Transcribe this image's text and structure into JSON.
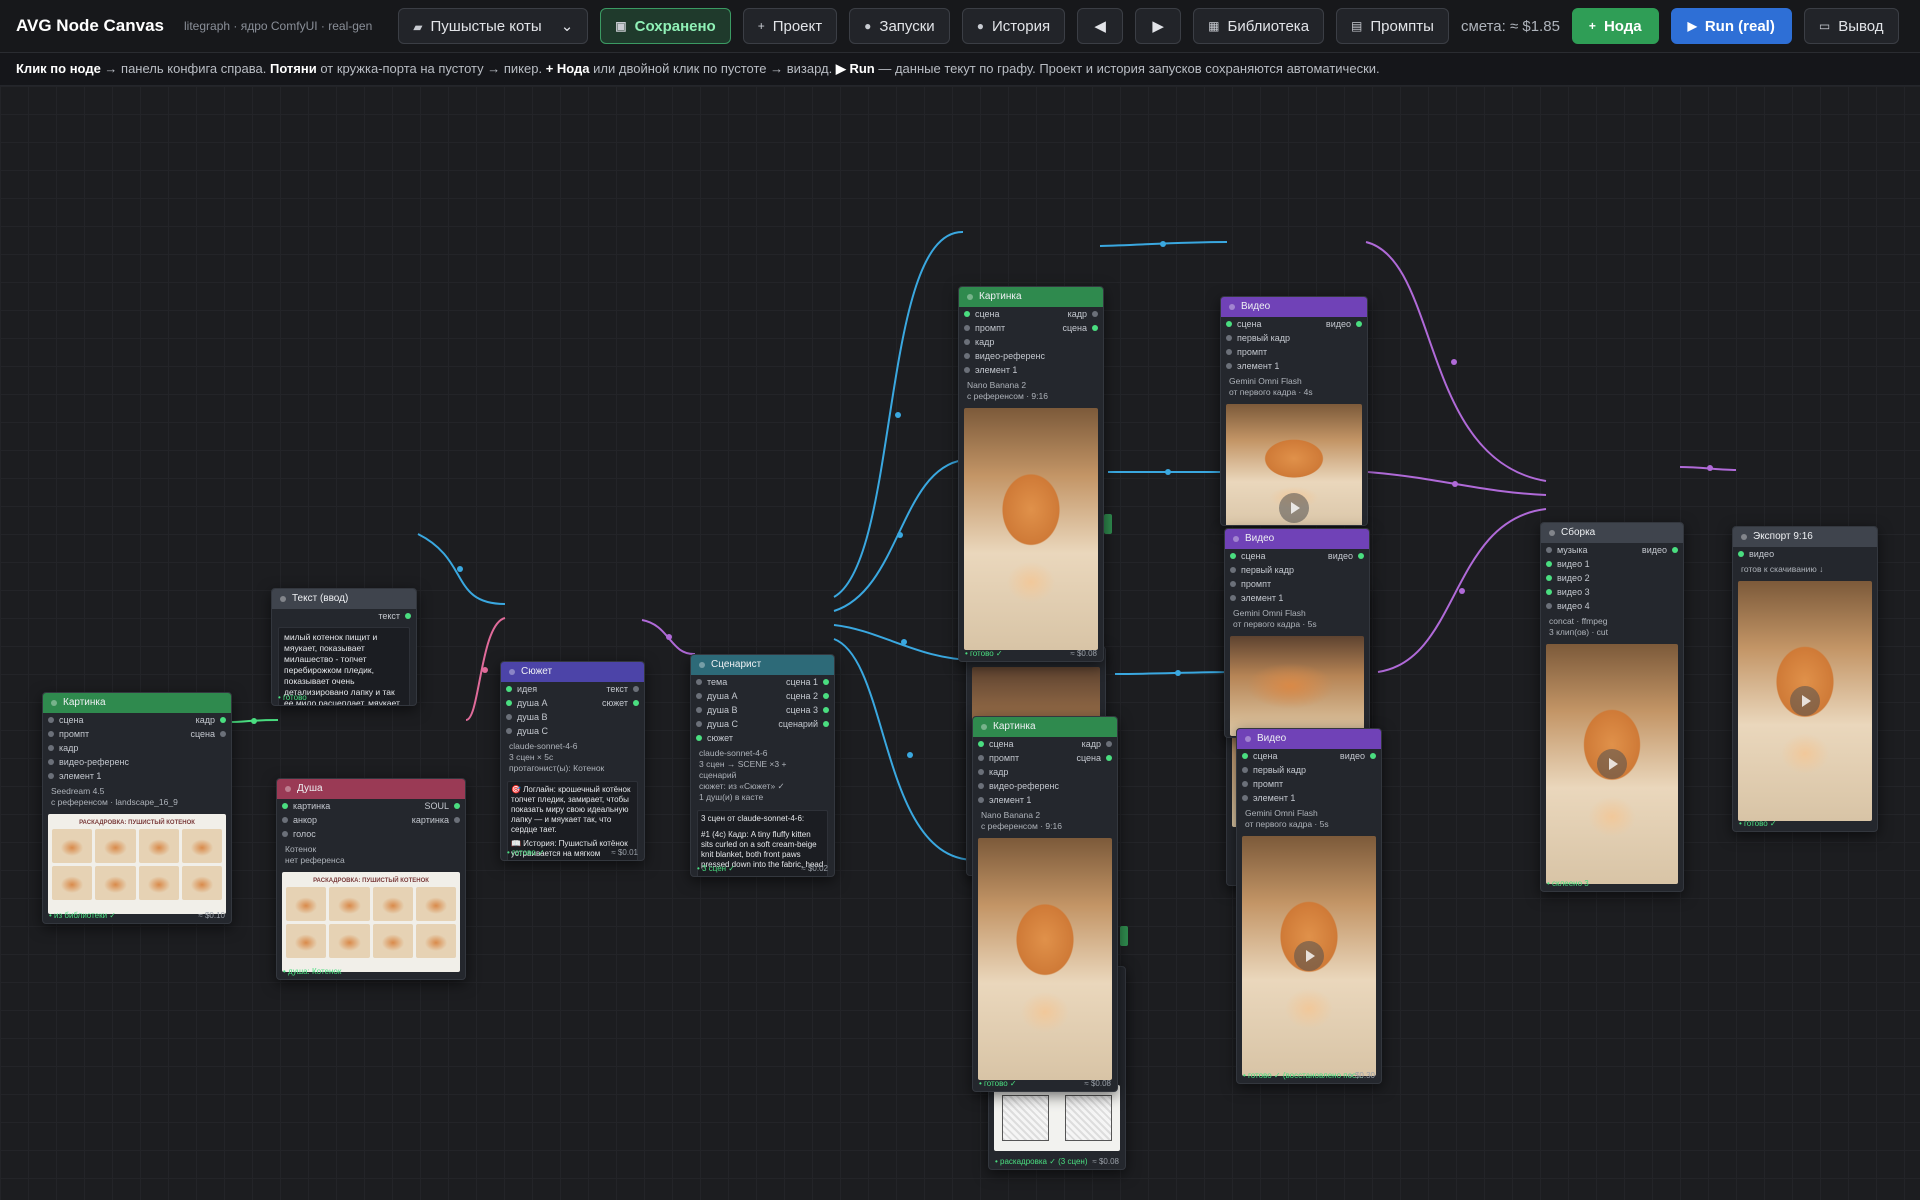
{
  "toolbar": {
    "title": "AVG Node Canvas",
    "subtitle": "litegraph · ядро ComfyUI · real-gen",
    "project_select": "Пушыстые коты",
    "saved": "Сохранено",
    "project": "Проект",
    "runs": "Запуски",
    "history": "История",
    "library": "Библиотека",
    "prompts": "Промпты",
    "cost": "смета: ≈ $1.85",
    "add_node": "Нода",
    "run": "Run (real)",
    "output": "Вывод"
  },
  "hint": {
    "p1": "Клик по ноде",
    "p2": " → панель конфига справа. ",
    "p3": "Потяни",
    "p4": " от кружка-порта на пустоту → пикер. ",
    "p5": "+ Нода",
    "p6": " или двойной клик по пустоте → визард. ",
    "p7": "▶ Run",
    "p8": " — данные текут по графу. Проект и история запусков сохраняются автоматически."
  },
  "colors": {
    "wire_blue": "#3aa8e0",
    "wire_purple": "#b06ad8",
    "wire_green": "#4ade80",
    "wire_pink": "#e06b9a"
  },
  "nodes": {
    "pic_left": {
      "title": "Картинка",
      "in": [
        "сцена",
        "промпт",
        "кадр",
        "видео-референс",
        "элемент 1"
      ],
      "out": [
        "кадр",
        "сцена"
      ],
      "meta": [
        "Seedream 4.5",
        "с референсом · landscape_16_9"
      ],
      "sheet_title": "РАСКАДРОВКА: ПУШИСТЫЙ КОТЕНОК",
      "status": "• из библиотеки ✓",
      "cost": "≈ $0.10"
    },
    "text_input": {
      "title": "Текст (ввод)",
      "out": "текст",
      "body": "милый котенок пищит и мяукает, показывает милашество - топчет перебирожком пледик, показывает очень детализировано лапку и так ее мило расцеплает, мяукает мило так же",
      "status": "• готово"
    },
    "soul": {
      "title": "Душа",
      "in": [
        "картинка",
        "анкор",
        "голос"
      ],
      "out": [
        "SOUL",
        "картинка"
      ],
      "meta": [
        "Котенок",
        "нет референса"
      ],
      "sheet_title": "РАСКАДРОВКА: ПУШИСТЫЙ КОТЕНОК",
      "status": "• душа: Котенок"
    },
    "plot": {
      "title": "Сюжет",
      "in": [
        "идея",
        "душа A",
        "душа B",
        "душа C"
      ],
      "out": [
        "текст",
        "сюжет"
      ],
      "meta": [
        "claude-sonnet-4-6",
        "3 сцен × 5с",
        "протагонист(ы): Котенок"
      ],
      "logline": "🎯 Логлайн: крошечный котёнок топчет пледик, замирает, чтобы показать миру свою идеальную лапку — и мяукает так, что сердце тает.",
      "story": "📖 История: Пушистый котёнок устраивается на мягком пледик…",
      "status": "• готово ✓",
      "cost": "≈ $0.01"
    },
    "writer": {
      "title": "Сценарист",
      "in": [
        "тема",
        "душа A",
        "душа B",
        "душа C",
        "сюжет"
      ],
      "out": [
        "сцена 1",
        "сцена 2",
        "сцена 3",
        "сценарий"
      ],
      "meta": [
        "claude-sonnet-4-6",
        "3 сцен → SCENE ×3 + сценарий",
        "сюжет: из «Сюжет» ✓",
        "1 душ(и) в касте"
      ],
      "box_head": "3 сцен от claude-sonnet-4-6:",
      "box_body": "#1 (4с) Кадр: A tiny fluffy kitten sits curled on a soft cream-beige knit blanket, both front paws pressed down into the fabric, head …",
      "status": "• 3 сцен ✓",
      "cost": "≈ $0.02"
    },
    "pic1": {
      "title": "Картинка",
      "in": [
        "сцена",
        "промпт",
        "кадр",
        "видео-референс",
        "элемент 1"
      ],
      "out": [
        "кадр",
        "сцена"
      ],
      "meta": [
        "Nano Banana 2",
        "с референсом · 9:16"
      ],
      "status": "• готово ✓",
      "cost": "≈ $0.08"
    },
    "pic2": {
      "title": "Картинка",
      "in": [
        "сцена",
        "промпт",
        "кадр",
        "видео-референс",
        "элемент 1"
      ],
      "out": [
        "кадр",
        "сцена"
      ],
      "meta": [
        "Nano Banana 2",
        "с референсом · 9:16"
      ],
      "status": "• готово ✓",
      "cost": "≈ $0.08"
    },
    "storyboard_peek": {
      "status": "• раскадровка ✓ (3 сцен)",
      "cost": "≈ $0.08"
    },
    "vid1": {
      "title": "Видео",
      "in": [
        "сцена",
        "первый кадр",
        "промпт",
        "элемент 1"
      ],
      "out": "видео",
      "meta": [
        "Gemini Omni Flash",
        "от первого кадра · 4s"
      ]
    },
    "vid2": {
      "title": "Видео",
      "in": [
        "сцена",
        "первый кадр",
        "промпт",
        "элемент 1"
      ],
      "out": "видео",
      "meta": [
        "Gemini Omni Flash",
        "от первого кадра · 5s"
      ]
    },
    "vid3": {
      "title": "Видео",
      "in": [
        "сцена",
        "первый кадр",
        "промпт",
        "элемент 1"
      ],
      "out": "видео",
      "meta": [
        "Gemini Omni Flash",
        "от первого кадра · 5s"
      ],
      "status": "• готово ✓ (восстановлено пос…",
      "cost": "≈ $0.30"
    },
    "assembly": {
      "title": "Сборка",
      "in": [
        "музыка",
        "видео 1",
        "видео 2",
        "видео 3",
        "видео 4"
      ],
      "out": "видео",
      "meta": [
        "concat · ffmpeg",
        "3 клип(ов) · cut"
      ],
      "status": "• склеено 3"
    },
    "export": {
      "title": "Экспорт 9:16",
      "in": "видео",
      "meta": "готов к скачиванию ↓",
      "status": "• готово ✓"
    }
  }
}
